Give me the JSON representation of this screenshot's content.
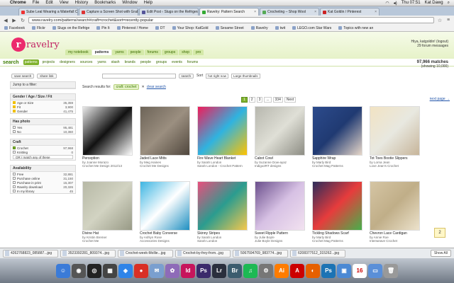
{
  "os_menubar": {
    "apple": "",
    "items": [
      "Chrome",
      "File",
      "Edit",
      "View",
      "History",
      "Bookmarks",
      "Window",
      "Help"
    ],
    "clock": "Thu 07:51",
    "user": "Kat Dawg"
  },
  "tabs": [
    {
      "label": "Sube Leal Wearing a Waterfall Cardigan",
      "color": "#e33"
    },
    {
      "label": "Capture a Screen Shot with Grab",
      "color": "#d33"
    },
    {
      "label": "Edit Post ‹ Slugs on the Refrigerator",
      "color": "#559"
    },
    {
      "label": "Ravelry: Pattern Search",
      "color": "#3a3",
      "active": true
    },
    {
      "label": "Crocheting – Shop Wool",
      "color": "#5a5"
    },
    {
      "label": "Kat Goldin / Pinterest",
      "color": "#c22"
    }
  ],
  "address": "www.ravelry.com/patterns/search#craft=crochet&sort=recently-popular",
  "bookmarks": [
    "Facebook",
    "Flickr",
    "Slugs on the Refrige",
    "Pin It",
    "Pinterest / Home",
    "DT",
    "Your Shop: KatGold",
    "Sesame Street",
    "Ravelry",
    "twit",
    "LEGO.com Star Wars",
    "Topics with new an"
  ],
  "site": {
    "logo": "ravelry",
    "nav": [
      "my notebook",
      "patterns",
      "yarns",
      "people",
      "forums",
      "groups",
      "shop",
      "pro"
    ],
    "user_line1": "Hiya, katgoldin! (logout)",
    "user_line2": "29 forum messages",
    "search_label": "search",
    "search_tabs": [
      "patterns",
      "projects",
      "designers",
      "sources",
      "yarns",
      "stash",
      "brands",
      "people",
      "groups",
      "events",
      "forums"
    ],
    "matches": "97,966 matches",
    "showing": "(showing 10,000)",
    "save_search": "save search",
    "share_link": "share link",
    "sort_label": "Sort",
    "sort_value": "hot right now",
    "view_value": "Large thumbnails",
    "search_btn": "search",
    "results_for": "Search results for:",
    "filter_chip": "craft: crochet",
    "clear_search": "clear search",
    "pages": [
      "1",
      "2",
      "3",
      "...",
      "334",
      "Next"
    ],
    "next_page": "next page →"
  },
  "sidebar": {
    "jump": "Jump to a filter:",
    "boxes": [
      {
        "title": "Gender / Age / Size / Fit",
        "rows": [
          {
            "l": "Age or Size",
            "c": "35,359",
            "icon": true
          },
          {
            "l": "Fit",
            "c": "3,900",
            "icon": true
          },
          {
            "l": "Gender",
            "c": "41,475",
            "icon": true
          }
        ]
      },
      {
        "title": "Has photo",
        "rows": [
          {
            "l": "Yes",
            "c": "95,481"
          },
          {
            "l": "No",
            "c": "10,360"
          }
        ]
      },
      {
        "title": "Craft",
        "rows": [
          {
            "l": "Crochet",
            "c": "97,968",
            "on": true
          },
          {
            "l": "Knitting",
            "c": "0"
          }
        ],
        "extra": "OR / match any of these"
      },
      {
        "title": "Availability",
        "rows": [
          {
            "l": "Free",
            "c": "32,881"
          },
          {
            "l": "Purchase online",
            "c": "31,150"
          },
          {
            "l": "Purchase in print",
            "c": "15,307"
          },
          {
            "l": "Ravelry download",
            "c": "20,326"
          },
          {
            "l": "In my library",
            "c": "45"
          }
        ]
      }
    ]
  },
  "results": [
    {
      "title": "Perception",
      "author": "by Joanne Morazo",
      "src": "Crochet Me Design 2012/13",
      "colors": [
        "#e9e9e9",
        "#111",
        "#fff"
      ]
    },
    {
      "title": "Jaded Lace Mitts",
      "author": "by Meg Haines",
      "src": "Crochet Me Designs",
      "colors": [
        "#6d6458",
        "#9b8f80",
        "#50473d"
      ]
    },
    {
      "title": "Fire Wave Heart Blanket",
      "author": "by Sarah London",
      "src": "Sarah London - Crochet Pattern",
      "colors": [
        "#f01c5a",
        "#2fb3e0",
        "#ffc300"
      ]
    },
    {
      "title": "Cabot Cowl",
      "author": "by Suzanne Dow-ayaz",
      "src": "Indigo2RT designs",
      "colors": [
        "#b7b7ae",
        "#dfdfd6",
        "#8d8d84"
      ]
    },
    {
      "title": "Sapphire Wrap",
      "author": "by Marly Bird",
      "src": "Crochet Mag Patterns",
      "colors": [
        "#2c4b8c",
        "#203a72",
        "#e7d7c9"
      ]
    },
    {
      "title": "Tot Toes Bootie Slippers",
      "author": "by Lorna Jean",
      "src": "Love Jean's Crochet",
      "colors": [
        "#f2e3c3",
        "#e8e8e0",
        "#c7b59a"
      ]
    },
    {
      "title": "Divine Hat",
      "author": "by Kristin Bremer",
      "src": "Crochet Me",
      "colors": [
        "#b7b9a6",
        "#d2d3c2",
        "#989a86"
      ]
    },
    {
      "title": "Crochet Baby Converse",
      "author": "by Ashlyn Rose",
      "src": "Accessories Designs",
      "colors": [
        "#3db5e2",
        "#ffffff",
        "#1e8fc1"
      ]
    },
    {
      "title": "Skinny Stripes",
      "author": "by Sarah London",
      "src": "Sarah London",
      "colors": [
        "#e94f7d",
        "#2a9c8f",
        "#f6c84c"
      ]
    },
    {
      "title": "Sweet Ripple Pattern",
      "author": "by Julie Boyle",
      "src": "Julie Boyle Designs",
      "colors": [
        "#6b4f8c",
        "#d7c1e4",
        "#f2e2f0"
      ]
    },
    {
      "title": "Tickling Shadows Scarf",
      "author": "by Marly Bird",
      "src": "Crochet Mag Patterns",
      "colors": [
        "#2c2c5a",
        "#e73c3c",
        "#47b04b"
      ]
    },
    {
      "title": "Chevron Lace Cardigan",
      "author": "by Annie Roe",
      "src": "Interweave Crochet",
      "colors": [
        "#d5c5a4",
        "#c0ae88",
        "#ece2cc"
      ]
    }
  ],
  "downloads": [
    "4262768823_085887...jpg",
    "3523392281_809374...jpg",
    "Crochet-week-Mollie...jpg",
    "Crochet-by-frey-from...jpg",
    "5067594769_983774...jpg",
    "6208377512_315262...jpg"
  ],
  "show_all": "Show All",
  "dock_apps": [
    {
      "name": "finder",
      "c": "#3b7bd8",
      "t": "☺"
    },
    {
      "name": "launchpad",
      "c": "#555",
      "t": "◉"
    },
    {
      "name": "dashboard",
      "c": "#222",
      "t": "◎"
    },
    {
      "name": "mission-control",
      "c": "#444",
      "t": "▦"
    },
    {
      "name": "safari",
      "c": "#2f84e8",
      "t": "◈"
    },
    {
      "name": "chrome",
      "c": "#d93025",
      "t": "●"
    },
    {
      "name": "mail",
      "c": "#7a9fcf",
      "t": "✉"
    },
    {
      "name": "photos",
      "c": "#8e6bb8",
      "t": "✿"
    },
    {
      "name": "indesign",
      "c": "#c7155c",
      "t": "Id"
    },
    {
      "name": "photoshop-elements",
      "c": "#3b2a6b",
      "t": "Ps"
    },
    {
      "name": "lightroom",
      "c": "#2b2f3d",
      "t": "Lr"
    },
    {
      "name": "bridge",
      "c": "#3c5c6e",
      "t": "Br"
    },
    {
      "name": "spotify",
      "c": "#1db954",
      "t": "♫"
    },
    {
      "name": "settings",
      "c": "#777",
      "t": "⚙"
    },
    {
      "name": "illustrator",
      "c": "#ff7c00",
      "t": "Ai"
    },
    {
      "name": "acrobat",
      "c": "#c00",
      "t": "A"
    },
    {
      "name": "firefox",
      "c": "#e66000",
      "t": "◐"
    },
    {
      "name": "photoshop",
      "c": "#1c73b4",
      "t": "Ps"
    },
    {
      "name": "preview",
      "c": "#4b89d4",
      "t": "▣"
    },
    {
      "name": "calendar",
      "c": "#fff",
      "t": "16"
    },
    {
      "name": "folder",
      "c": "#5a8fd8",
      "t": "▭"
    },
    {
      "name": "trash",
      "c": "#999",
      "t": "🗑"
    }
  ],
  "notification_count": "2"
}
